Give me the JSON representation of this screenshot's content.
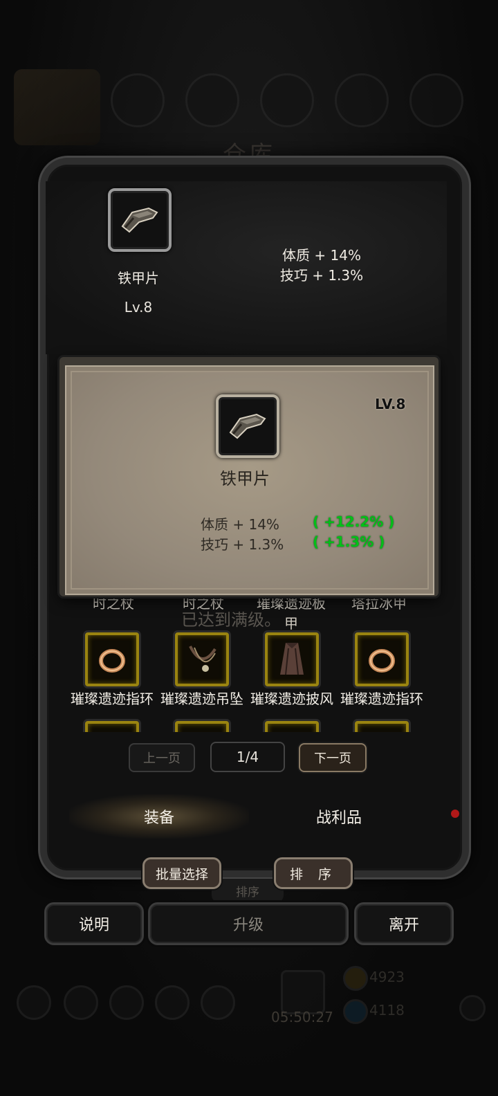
{
  "background": {
    "title": "仓库",
    "maxed_text": "已达到满级。",
    "faded_labels": [
      "时之杖",
      "时之杖",
      "璀璨遗迹板甲",
      "塔拉冰甲"
    ],
    "gold": "4923",
    "gems": "4118",
    "timer": "05:50:27"
  },
  "compare_panel": {
    "item_name": "铁甲片",
    "level": "Lv.8",
    "stats": [
      "体质 + 14%",
      "技巧 + 1.3%"
    ]
  },
  "tooltip": {
    "level": "LV.8",
    "item_name": "铁甲片",
    "stats": [
      {
        "text": "体质 + 14%",
        "bonus": "( +12.2% )"
      },
      {
        "text": "技巧 + 1.3%",
        "bonus": "( +1.3% )"
      }
    ],
    "bonus_color": "#00c018"
  },
  "inventory": {
    "items": [
      {
        "name": "璀璨遗迹指环",
        "icon": "ring-icon"
      },
      {
        "name": "璀璨遗迹吊坠",
        "icon": "pendant-icon"
      },
      {
        "name": "璀璨遗迹披风",
        "icon": "cloak-icon"
      },
      {
        "name": "璀璨遗迹指环",
        "icon": "ring-icon"
      }
    ],
    "slot_border_color": "#9a8410"
  },
  "pagination": {
    "prev_label": "上一页",
    "counter": "1/4",
    "next_label": "下一页"
  },
  "tabs": {
    "equip_label": "装备",
    "loot_label": "战利品",
    "active": "装备"
  },
  "actions": {
    "batch_select_label": "批量选择",
    "sort_label": "排 序",
    "ghost_sort_label": "排序"
  },
  "bottom_bar": {
    "help_label": "说明",
    "upgrade_label": "升级",
    "leave_label": "离开"
  }
}
